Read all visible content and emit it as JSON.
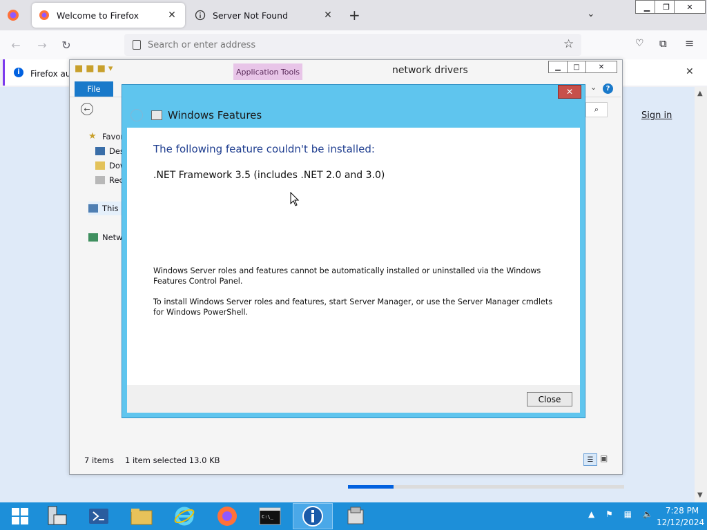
{
  "firefox": {
    "tabs": [
      {
        "label": "Welcome to Firefox"
      },
      {
        "label": "Server Not Found"
      }
    ],
    "new_tab_glyph": "+",
    "close_glyph": "✕",
    "address_placeholder": "Search or enter address",
    "notification_text": "Firefox aut",
    "sign_in": "Sign in",
    "window_buttons": {
      "min": "▁",
      "max": "❐",
      "close": "✕"
    }
  },
  "explorer": {
    "title": "network drivers",
    "context_tab": "Application Tools",
    "file_tab": "File",
    "nav_items": [
      {
        "label": "Favor",
        "icon": "star-icon"
      },
      {
        "label": "Des",
        "icon": "desktop-icon"
      },
      {
        "label": "Dow",
        "icon": "downloads-icon"
      },
      {
        "label": "Rec",
        "icon": "recent-icon"
      },
      {
        "label": "This I",
        "icon": "this-pc-icon"
      },
      {
        "label": "Netw",
        "icon": "network-icon"
      }
    ],
    "status_items": "7 items",
    "status_selected": "1 item selected  13.0 KB",
    "help_glyph": "?"
  },
  "dialog": {
    "title": "Windows Features",
    "heading": "The following feature couldn't be installed:",
    "feature": ".NET Framework 3.5 (includes .NET 2.0 and 3.0)",
    "paragraph1": "Windows Server roles and features cannot be automatically installed or uninstalled via the Windows Features Control Panel.",
    "paragraph2": "To install Windows Server roles and features, start Server Manager, or use the Server Manager cmdlets for Windows PowerShell.",
    "close_button": "Close"
  },
  "taskbar": {
    "apps": [
      "start",
      "server-manager",
      "powershell",
      "file-explorer",
      "internet-explorer",
      "firefox",
      "command-prompt",
      "info",
      "windows-features"
    ],
    "clock_time": "7:28 PM",
    "clock_date": "12/12/2024"
  },
  "colors": {
    "dialog_frame": "#5fc5ee",
    "dialog_heading": "#1e3d8f",
    "taskbar": "#1d8fd9",
    "file_tab": "#1979ca"
  }
}
